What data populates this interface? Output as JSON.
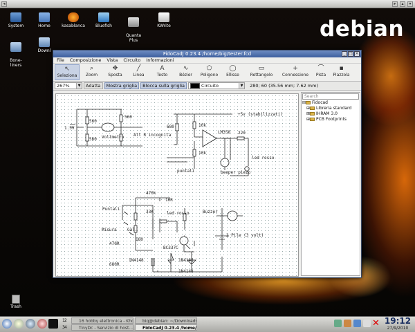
{
  "desktop": {
    "logo": "debian",
    "icons": [
      {
        "label": "System"
      },
      {
        "label": "Home"
      },
      {
        "label": "kasablanca"
      },
      {
        "label": "Bluefish"
      },
      {
        "label": "Quanta\nPlus"
      },
      {
        "label": "KWrite"
      },
      {
        "label": "Bone-\nliners"
      },
      {
        "label": "Downl"
      }
    ],
    "trash": "Trash"
  },
  "window": {
    "title": "FidoCadJ 0.23.4 /home/big/tester.fcd",
    "menu": [
      "File",
      "Composizione",
      "Vista",
      "Circuito",
      "Informazioni"
    ],
    "tools": [
      {
        "label": "Seleziona",
        "glyph": "↖",
        "selected": true
      },
      {
        "label": "Zoom",
        "glyph": "⌕"
      },
      {
        "label": "Sposta",
        "glyph": "✥"
      },
      {
        "label": "Linea",
        "glyph": "╱"
      },
      {
        "label": "Testo",
        "glyph": "A"
      },
      {
        "label": "Bézier",
        "glyph": "∿"
      },
      {
        "label": "Poligono",
        "glyph": "⬠"
      },
      {
        "label": "Ellisse",
        "glyph": "◯"
      },
      {
        "label": "Rettangolo",
        "glyph": "▭"
      },
      {
        "label": "Connessione",
        "glyph": "+"
      },
      {
        "label": "Pista",
        "glyph": "⌒"
      },
      {
        "label": "Piazzola",
        "glyph": "▪"
      }
    ],
    "zoom": "267%",
    "adatta": "Adatta",
    "mostra_griglia": "Mostra griglia",
    "blocca_griglia": "Blocca sulla griglia",
    "layer": "Circuito",
    "coords": "280; 60 (35.56 mm; 7.62 mm)",
    "search_placeholder": "Search",
    "library_tree": [
      {
        "label": "Fidocad",
        "level": 0
      },
      {
        "label": "Libreria standard",
        "level": 1
      },
      {
        "label": "IHRAM 3.0",
        "level": 1
      },
      {
        "label": "PCB Footprints",
        "level": 1
      }
    ]
  },
  "schematic": {
    "labels": {
      "r560a": "560",
      "r560b": "560",
      "r560c": "560",
      "v15": "1.5V",
      "voltmetro": "Voltmetro",
      "all_r": "All R incognita",
      "v5": "+5v (stabilizzati)",
      "r680": "680",
      "r10k_a": "10k",
      "r10k_b": "10k",
      "lm358": "LM358",
      "r220": "220",
      "led_rosso_a": "led rosso",
      "beeper": "beeper\npiezo",
      "puntali_a": "puntali",
      "r470k": "470k",
      "r33k": "33K",
      "r10r": "10R",
      "led_rosso_b": "led rosso",
      "buzzer": "Buzzer",
      "puntali_b": "Puntali",
      "misura": "Misura",
      "gal": "Gal.",
      "r470r": "470R",
      "r180": "180",
      "bc337": "BC337C",
      "r680r": "680R",
      "d1n4148_a": "1N4148",
      "d1n4148_b": "1N4148",
      "d1n4148_c": "1N4148",
      "pile": "2 Pile (3 volt)"
    }
  },
  "taskbar": {
    "pager": [
      "1",
      "2",
      "3",
      "4"
    ],
    "tasks": [
      {
        "label": "16 hobby elettronica - Kho..."
      },
      {
        "label": "big@debian: ~/Downloads"
      },
      {
        "label": "TinyDc - Servizio di host..."
      },
      {
        "label": "FidoCadJ 0.23.4 /home/bi...",
        "active": true
      }
    ],
    "time": "19:12",
    "date": "27/9/2010"
  }
}
